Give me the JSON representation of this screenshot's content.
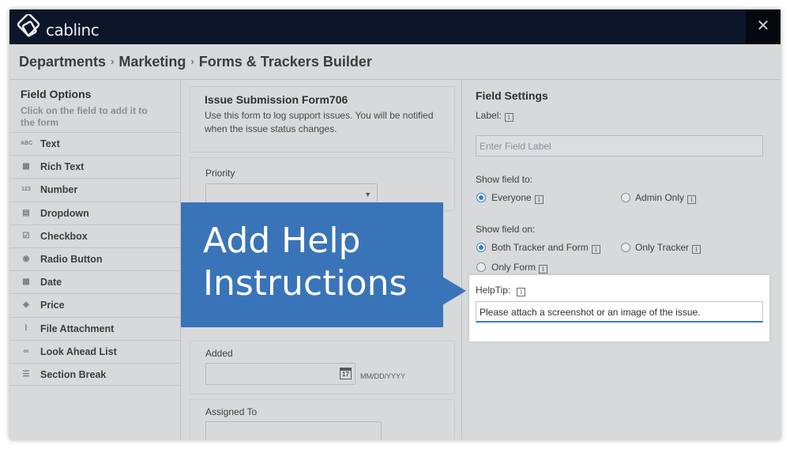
{
  "app": {
    "logo_text": "cablinc",
    "close_label": "✕"
  },
  "breadcrumb": {
    "items": [
      "Departments",
      "Marketing",
      "Forms & Trackers Builder"
    ],
    "separator": "›"
  },
  "field_options": {
    "title": "Field Options",
    "subtitle": "Click on the field to add it to the form",
    "items": [
      {
        "label": "Text",
        "icon": "text-abc-icon",
        "glyph": "ABC"
      },
      {
        "label": "Rich Text",
        "icon": "rich-text-icon",
        "glyph": "▦"
      },
      {
        "label": "Number",
        "icon": "number-123-icon",
        "glyph": "123"
      },
      {
        "label": "Dropdown",
        "icon": "dropdown-icon",
        "glyph": "▤"
      },
      {
        "label": "Checkbox",
        "icon": "checkbox-icon",
        "glyph": "☑"
      },
      {
        "label": "Radio Button",
        "icon": "radio-icon",
        "glyph": "◉"
      },
      {
        "label": "Date",
        "icon": "calendar-icon",
        "glyph": "▦"
      },
      {
        "label": "Price",
        "icon": "price-tag-icon",
        "glyph": "◈"
      },
      {
        "label": "File Attachment",
        "icon": "paperclip-icon",
        "glyph": "⌇"
      },
      {
        "label": "Look Ahead List",
        "icon": "binoculars-icon",
        "glyph": "∞"
      },
      {
        "label": "Section Break",
        "icon": "section-break-icon",
        "glyph": "☰"
      }
    ]
  },
  "form": {
    "title": "Issue Submission Form706",
    "description": "Use this form to log support issues. You will be notified when the issue status changes.",
    "priority_label": "Priority",
    "added_label": "Added",
    "date_format": "MM/DD/YYYY",
    "date_icon_day": "17",
    "assigned_label": "Assigned To"
  },
  "field_settings": {
    "title": "Field Settings",
    "label_title": "Label:",
    "label_placeholder": "Enter Field Label",
    "show_to_title": "Show field to:",
    "show_to_options": [
      {
        "label": "Everyone",
        "selected": true
      },
      {
        "label": "Admin Only",
        "selected": false
      }
    ],
    "show_on_title": "Show field on:",
    "show_on_options": [
      {
        "label": "Both Tracker and Form",
        "selected": true
      },
      {
        "label": "Only Tracker",
        "selected": false
      },
      {
        "label": "Only Form",
        "selected": false
      }
    ],
    "helptip_title": "HelpTip:",
    "helptip_value": "Please attach a screenshot or an image of the issue.",
    "info_glyph": "i"
  },
  "callout": {
    "line1": "Add Help",
    "line2": "Instructions"
  },
  "colors": {
    "topbar": "#0c1628",
    "callout": "#3a74b8",
    "radio_selected": "#3a7bc8",
    "overlay_background": "#d8d9db"
  }
}
